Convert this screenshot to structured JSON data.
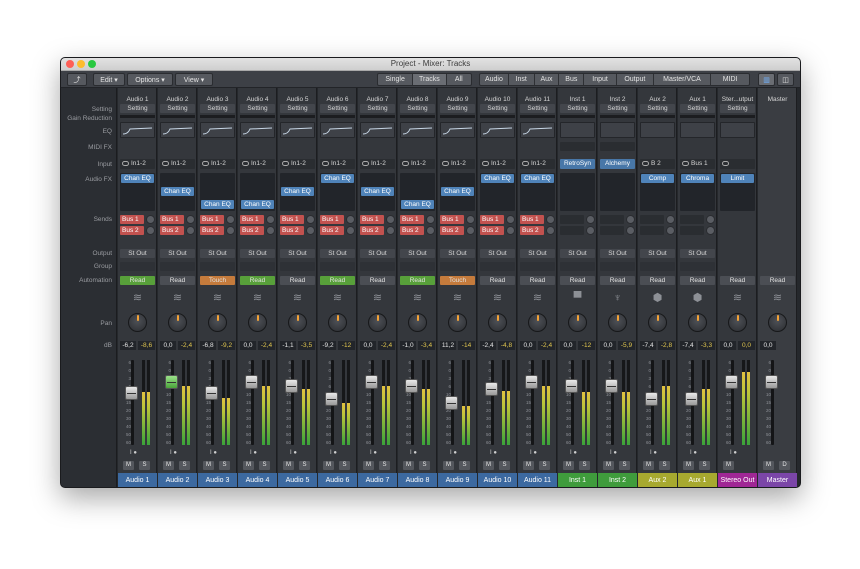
{
  "window": {
    "title": "Project - Mixer: Tracks"
  },
  "toolbar": {
    "edit": "Edit",
    "options": "Options",
    "view": "View",
    "filters": [
      "Single",
      "Tracks",
      "All"
    ],
    "types": [
      "Audio",
      "Inst",
      "Aux",
      "Bus",
      "Input",
      "Output",
      "Master/VCA",
      "MIDI"
    ]
  },
  "row_labels": {
    "setting": "Setting",
    "gain_reduction": "Gain Reduction",
    "eq": "EQ",
    "midi_fx": "MIDI FX",
    "input": "Input",
    "audio_fx": "Audio FX",
    "sends": "Sends",
    "output": "Output",
    "group": "Group",
    "automation": "Automation",
    "pan": "Pan",
    "db": "dB"
  },
  "scale": [
    "6",
    "0",
    "3",
    "6",
    "10",
    "15",
    "20",
    "30",
    "40",
    "50",
    "60"
  ],
  "colors": {
    "audio": "#3c69a0",
    "inst": "#3f9c3c",
    "aux": "#a7a92f",
    "stereo_out": "#a02795",
    "master": "#7b46a8",
    "send": "#c2524f",
    "fx": "#4f83b9",
    "auto_read_green": "#58a03a",
    "auto_touch": "#c57b3c"
  },
  "strips": [
    {
      "name": "Audio 1",
      "setting": "Setting",
      "input": "In1-2",
      "fx": [
        "Chan EQ"
      ],
      "fx_slot": 0,
      "sends": [
        "Bus 1",
        "Bus 2"
      ],
      "output": "St Out",
      "automation": "Read",
      "auto_style": "green",
      "icon": "waveform-icon",
      "db_a": "-6,2",
      "db_b": "-8,6",
      "level": 0.7,
      "meter": 0.62,
      "mode": "audio",
      "buttons": [
        "M",
        "S"
      ]
    },
    {
      "name": "Audio 2",
      "setting": "Setting",
      "input": "In1-2",
      "fx": [
        "Chan EQ"
      ],
      "fx_slot": 1,
      "sends": [
        "Bus 1",
        "Bus 2"
      ],
      "output": "St Out",
      "automation": "Read",
      "auto_style": "plain",
      "icon": "waveform-icon",
      "db_a": "0,0",
      "db_b": "-2,4",
      "level": 0.82,
      "meter": 0.7,
      "mode": "audio",
      "green_fader": true,
      "buttons": [
        "M",
        "S"
      ]
    },
    {
      "name": "Audio 3",
      "setting": "Setting",
      "input": "In1-2",
      "fx": [
        "Chan EQ"
      ],
      "fx_slot": 2,
      "sends": [
        "Bus 1",
        "Bus 2"
      ],
      "output": "St Out",
      "automation": "Touch",
      "auto_style": "touch",
      "icon": "waveform-icon",
      "db_a": "-6,8",
      "db_b": "-9,2",
      "level": 0.7,
      "meter": 0.55,
      "mode": "audio",
      "buttons": [
        "M",
        "S"
      ]
    },
    {
      "name": "Audio 4",
      "setting": "Setting",
      "input": "In1-2",
      "fx": [
        "Chan EQ"
      ],
      "fx_slot": 2,
      "sends": [
        "Bus 1",
        "Bus 2"
      ],
      "output": "St Out",
      "automation": "Read",
      "auto_style": "green",
      "icon": "waveform-icon",
      "db_a": "0,0",
      "db_b": "-2,4",
      "level": 0.82,
      "meter": 0.7,
      "mode": "audio",
      "buttons": [
        "M",
        "S"
      ]
    },
    {
      "name": "Audio 5",
      "setting": "Setting",
      "input": "In1-2",
      "fx": [
        "Chan EQ"
      ],
      "fx_slot": 1,
      "sends": [
        "Bus 1",
        "Bus 2"
      ],
      "output": "St Out",
      "automation": "Read",
      "auto_style": "plain",
      "icon": "waveform-icon",
      "db_a": "-1,1",
      "db_b": "-3,5",
      "level": 0.78,
      "meter": 0.66,
      "mode": "audio",
      "buttons": [
        "M",
        "S"
      ]
    },
    {
      "name": "Audio 6",
      "setting": "Setting",
      "input": "In1-2",
      "fx": [
        "Chan EQ"
      ],
      "fx_slot": 0,
      "sends": [
        "Bus 1",
        "Bus 2"
      ],
      "output": "St Out",
      "automation": "Read",
      "auto_style": "green",
      "icon": "waveform-icon",
      "db_a": "-9,2",
      "db_b": "-12",
      "level": 0.62,
      "meter": 0.5,
      "mode": "audio",
      "buttons": [
        "M",
        "S"
      ]
    },
    {
      "name": "Audio 7",
      "setting": "Setting",
      "input": "In1-2",
      "fx": [
        "Chan EQ"
      ],
      "fx_slot": 1,
      "sends": [
        "Bus 1",
        "Bus 2"
      ],
      "output": "St Out",
      "automation": "Read",
      "auto_style": "plain",
      "icon": "waveform-icon",
      "db_a": "0,0",
      "db_b": "-2,4",
      "level": 0.82,
      "meter": 0.7,
      "mode": "audio",
      "buttons": [
        "M",
        "S"
      ]
    },
    {
      "name": "Audio 8",
      "setting": "Setting",
      "input": "In1-2",
      "fx": [
        "Chan EQ"
      ],
      "fx_slot": 2,
      "sends": [
        "Bus 1",
        "Bus 2"
      ],
      "output": "St Out",
      "automation": "Read",
      "auto_style": "green",
      "icon": "waveform-icon",
      "db_a": "-1,0",
      "db_b": "-3,4",
      "level": 0.78,
      "meter": 0.66,
      "mode": "audio",
      "buttons": [
        "M",
        "S"
      ]
    },
    {
      "name": "Audio 9",
      "setting": "Setting",
      "input": "In1-2",
      "fx": [
        "Chan EQ"
      ],
      "fx_slot": 1,
      "sends": [
        "Bus 1",
        "Bus 2"
      ],
      "output": "St Out",
      "automation": "Touch",
      "auto_style": "touch",
      "icon": "waveform-icon",
      "db_a": "11,2",
      "db_b": "-14",
      "level": 0.58,
      "meter": 0.46,
      "mode": "audio",
      "buttons": [
        "M",
        "S"
      ]
    },
    {
      "name": "Audio 10",
      "setting": "Setting",
      "input": "In1-2",
      "fx": [
        "Chan EQ"
      ],
      "fx_slot": 0,
      "sends": [
        "Bus 1",
        "Bus 2"
      ],
      "output": "St Out",
      "automation": "Read",
      "auto_style": "plain",
      "icon": "waveform-icon",
      "db_a": "-2,4",
      "db_b": "-4,8",
      "level": 0.74,
      "meter": 0.64,
      "mode": "audio",
      "buttons": [
        "M",
        "S"
      ]
    },
    {
      "name": "Audio 11",
      "setting": "Setting",
      "input": "In1-2",
      "fx": [
        "Chan EQ"
      ],
      "fx_slot": 0,
      "sends": [
        "Bus 1",
        "Bus 2"
      ],
      "output": "St Out",
      "automation": "Read",
      "auto_style": "plain",
      "icon": "waveform-icon",
      "db_a": "0,0",
      "db_b": "-2,4",
      "level": 0.82,
      "meter": 0.7,
      "mode": "audio",
      "buttons": [
        "M",
        "S"
      ]
    },
    {
      "name": "Inst 1",
      "setting": "Setting",
      "input": "RetroSyn",
      "fx": [],
      "fx_slot": 0,
      "sends": [
        "",
        ""
      ],
      "output": "St Out",
      "automation": "Read",
      "auto_style": "plain",
      "icon": "synth-icon",
      "db_a": "0,0",
      "db_b": "-12",
      "level": 0.78,
      "meter": 0.62,
      "mode": "inst",
      "buttons": [
        "M",
        "S"
      ]
    },
    {
      "name": "Inst 2",
      "setting": "Setting",
      "input": "Alchemy",
      "fx": [],
      "fx_slot": 0,
      "sends": [
        "",
        ""
      ],
      "output": "St Out",
      "automation": "Read",
      "auto_style": "plain",
      "icon": "keyboard-icon",
      "db_a": "0,0",
      "db_b": "-5,9",
      "level": 0.78,
      "meter": 0.62,
      "mode": "inst",
      "buttons": [
        "M",
        "S"
      ]
    },
    {
      "name": "Aux 2",
      "setting": "Setting",
      "input": "B 2",
      "fx": [
        "Comp"
      ],
      "fx_slot": 0,
      "sends": [
        "",
        ""
      ],
      "output": "St Out",
      "automation": "Read",
      "auto_style": "plain",
      "icon": "aux-icon",
      "db_a": "-7,4",
      "db_b": "-2,8",
      "level": 0.62,
      "meter": 0.7,
      "mode": "aux",
      "buttons": [
        "M",
        "S"
      ]
    },
    {
      "name": "Aux 1",
      "setting": "Setting",
      "input": "Bus 1",
      "fx": [
        "Chroma"
      ],
      "fx_slot": 0,
      "sends": [
        "",
        ""
      ],
      "output": "St Out",
      "automation": "Read",
      "auto_style": "plain",
      "icon": "aux-icon",
      "db_a": "-7,4",
      "db_b": "-3,3",
      "level": 0.62,
      "meter": 0.66,
      "mode": "aux",
      "buttons": [
        "M",
        "S"
      ]
    },
    {
      "name": "Ster...utput",
      "setting": "Setting",
      "input": "",
      "fx": [
        "Limit"
      ],
      "fx_slot": 0,
      "sends": [],
      "output": "",
      "automation": "Read",
      "auto_style": "plain",
      "icon": "waveform-icon",
      "db_a": "0,0",
      "db_b": "0,0",
      "level": 0.82,
      "meter": 0.86,
      "mode": "out",
      "buttons": [
        "M"
      ]
    },
    {
      "name": "Master",
      "setting": "",
      "input": "",
      "fx": [],
      "fx_slot": 0,
      "sends": [],
      "output": "",
      "automation": "Read",
      "auto_style": "plain",
      "icon": "waveform-icon",
      "db_a": "0,0",
      "db_b": "",
      "level": 0.82,
      "meter": 0,
      "mode": "master",
      "buttons": [
        "M",
        "D"
      ]
    }
  ],
  "name_bars": [
    "Audio 1",
    "Audio 2",
    "Audio 3",
    "Audio 4",
    "Audio 5",
    "Audio 6",
    "Audio 7",
    "Audio 8",
    "Audio 9",
    "Audio 10",
    "Audio 11",
    "Inst 1",
    "Inst 2",
    "Aux 2",
    "Aux 1",
    "Stereo Out",
    "Master"
  ]
}
